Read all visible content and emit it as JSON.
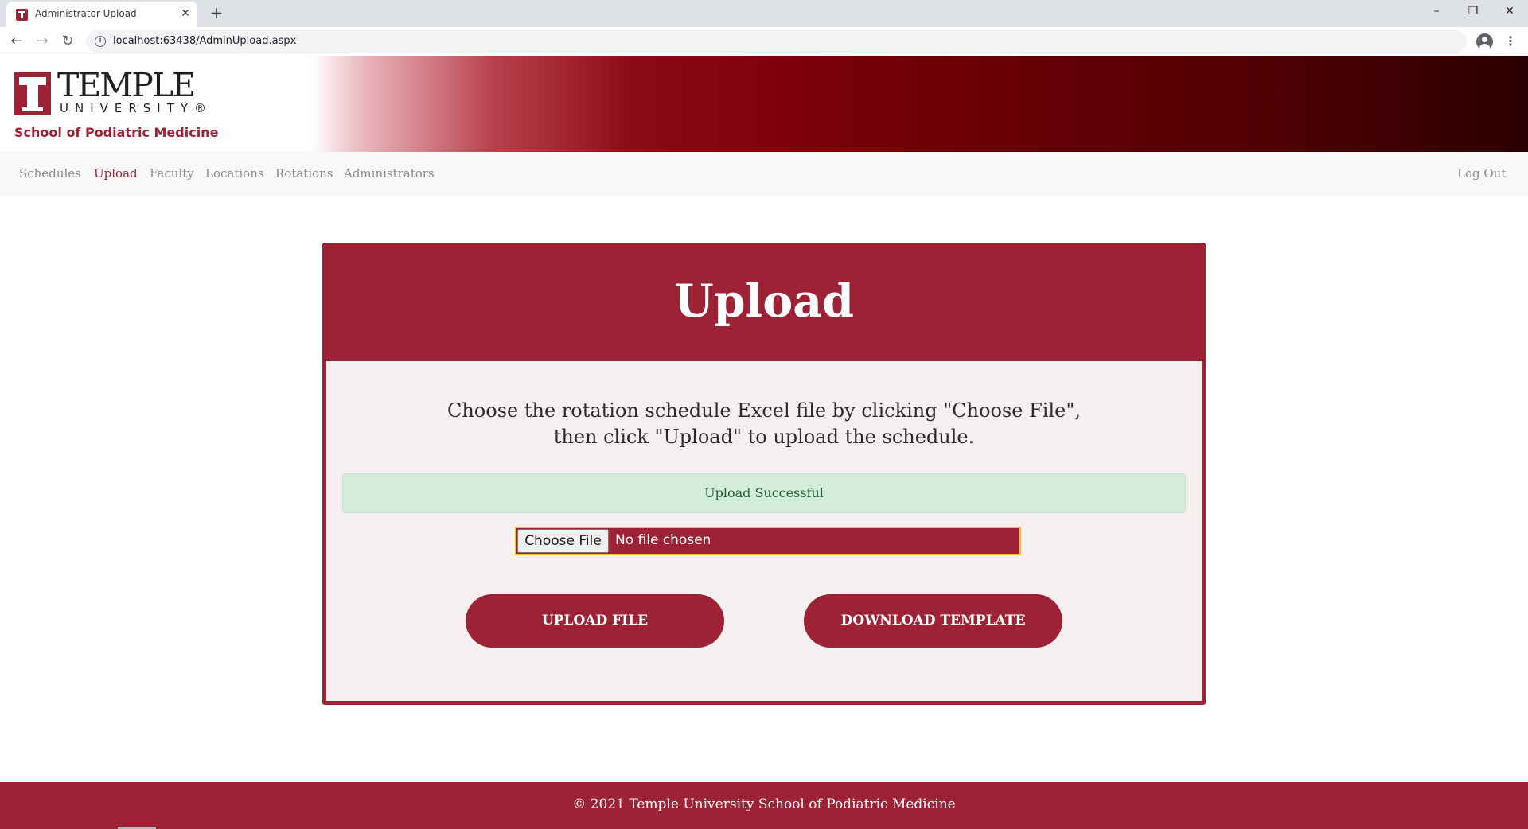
{
  "browser": {
    "tab_title": "Administrator Upload",
    "tab_close": "✕",
    "new_tab": "+",
    "url": "localhost:63438/AdminUpload.aspx",
    "window_controls": {
      "minimize": "–",
      "maximize": "❐",
      "close": "✕"
    },
    "nav": {
      "back": "←",
      "forward": "→",
      "reload": "↻"
    },
    "menu": "⋮"
  },
  "header": {
    "logo_word": "TEMPLE",
    "logo_sub": "UNIVERSITY®",
    "school_name": "School of Podiatric Medicine"
  },
  "nav": {
    "items": [
      {
        "label": "Schedules",
        "active": false
      },
      {
        "label": "Upload",
        "active": true
      },
      {
        "label": "Faculty",
        "active": false
      },
      {
        "label": "Locations",
        "active": false
      },
      {
        "label": "Rotations",
        "active": false
      },
      {
        "label": "Administrators",
        "active": false
      }
    ],
    "logout": "Log Out"
  },
  "card": {
    "title": "Upload",
    "instructions_line1": "Choose the rotation schedule Excel file by clicking \"Choose File\",",
    "instructions_line2": "then click \"Upload\" to upload the schedule.",
    "alert": "Upload Successful",
    "choose_file_label": "Choose File",
    "file_status": "No file chosen",
    "upload_button": "UPLOAD FILE",
    "download_button": "DOWNLOAD TEMPLATE"
  },
  "footer": {
    "copyright": "© 2021 Temple University School of Podiatric Medicine"
  },
  "colors": {
    "brand": "#9d2235",
    "alert_bg": "#d4eddb",
    "alert_text": "#1f5e33",
    "focus_outline": "#f2c12e",
    "card_body": "#f5f0ef"
  }
}
